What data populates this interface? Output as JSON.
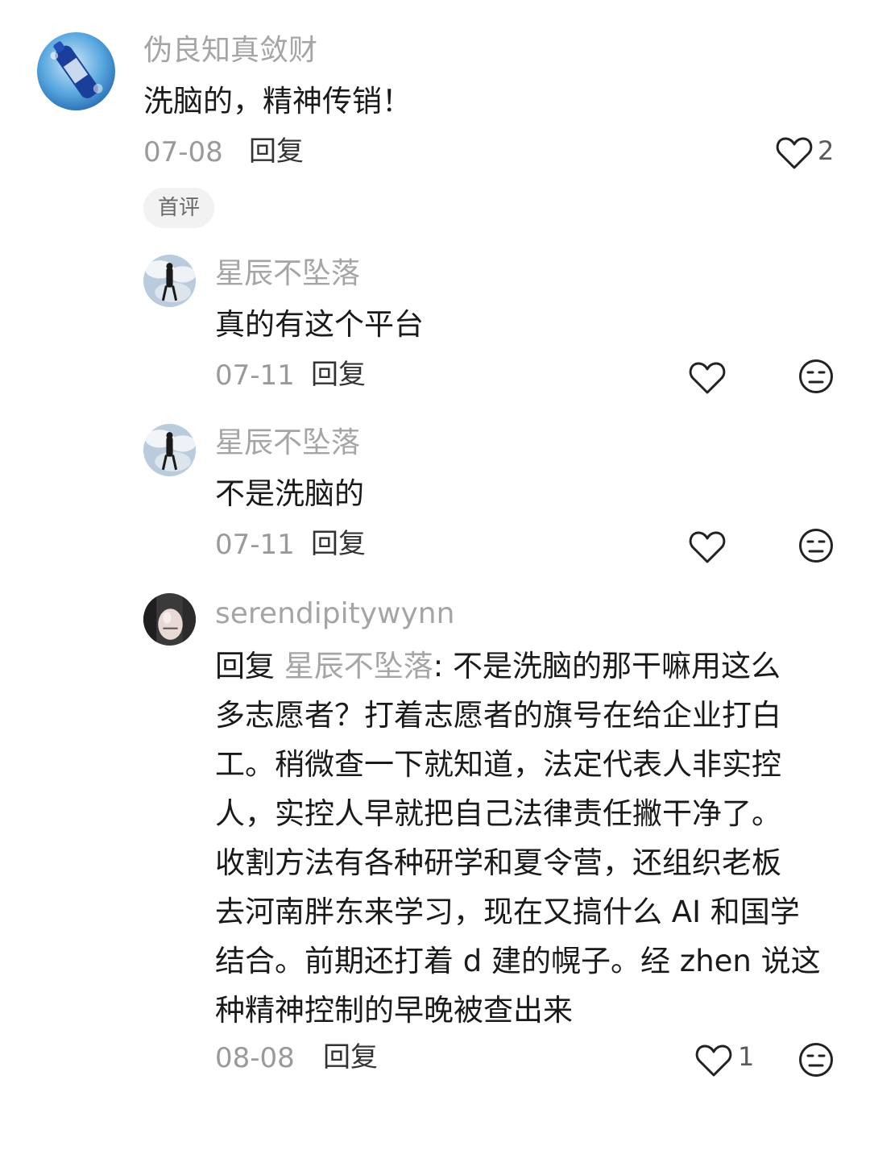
{
  "comments": {
    "main": {
      "username": "伪良知真敛财",
      "text": "洗脑的，精神传销！",
      "date": "07-08",
      "reply_label": "回复",
      "likes": "2",
      "tag": "首评"
    },
    "reply1": {
      "username": "星辰不坠落",
      "text": "真的有这个平台",
      "date": "07-11",
      "reply_label": "回复"
    },
    "reply2": {
      "username": "星辰不坠落",
      "text": "不是洗脑的",
      "date": "07-11",
      "reply_label": "回复"
    },
    "reply3": {
      "username": "serendipitywynn",
      "reply_prefix": "回复 ",
      "reply_target": "星辰不坠落",
      "lines": [
        ": 不是洗脑的那干嘛用这么",
        "多志愿者？打着志愿者的旗号在给企业打白",
        "工。稍微查一下就知道，法定代表人非实控",
        "人，实控人早就把自己法律责任撇干净了。",
        "收割方法有各种研学和夏令营，还组织老板",
        "去河南胖东来学习，现在又搞什么 AI 和国学",
        "结合。前期还打着 d 建的幌子。经 zhen 说这",
        "种精神控制的早晚被查出来"
      ],
      "date": "08-08",
      "reply_label": "回复",
      "likes": "1"
    }
  },
  "icons": {
    "like": "heart-outline-icon",
    "dislike": "neutral-face-icon"
  }
}
